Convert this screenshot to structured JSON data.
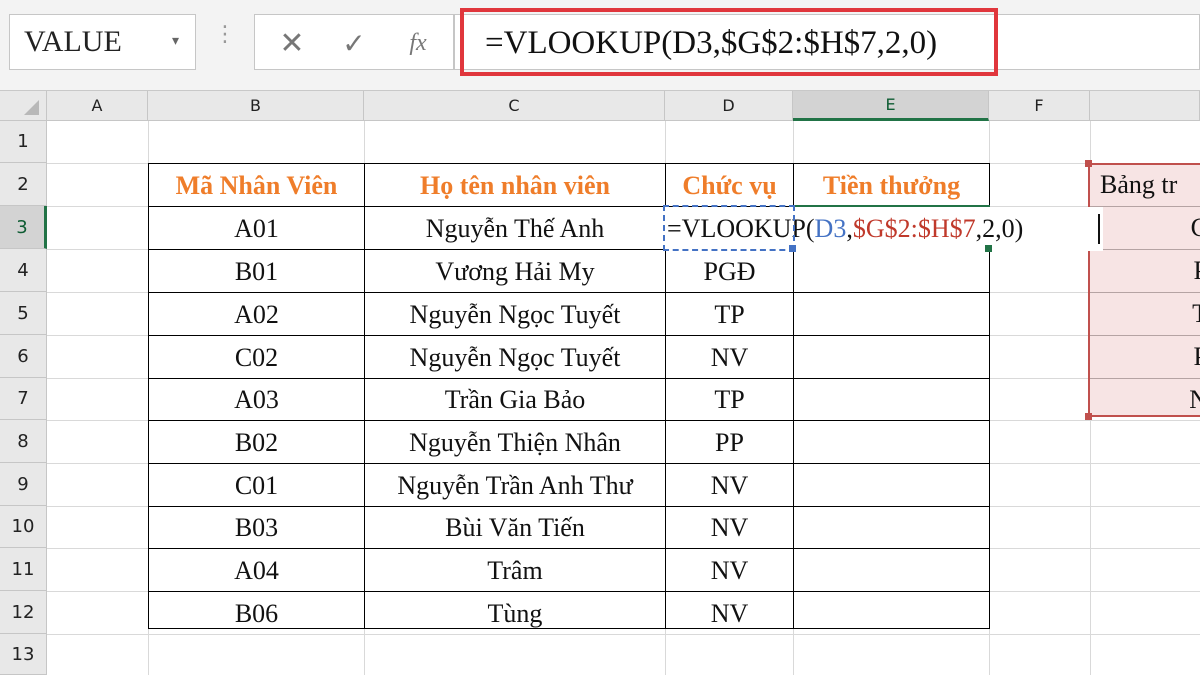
{
  "formula_bar": {
    "name_box": "VALUE",
    "name_box_arrow": "▾",
    "separator": "⋮",
    "cancel_icon": "✕",
    "enter_icon": "✓",
    "fx_label": "fx",
    "formula": "=VLOOKUP(D3,$G$2:$H$7,2,0)",
    "highlight_color": "#e0363c"
  },
  "columns": [
    "A",
    "B",
    "C",
    "D",
    "E",
    "F"
  ],
  "rows": [
    "1",
    "2",
    "3",
    "4",
    "5",
    "6",
    "7",
    "8",
    "9",
    "10",
    "11",
    "12",
    "13"
  ],
  "table": {
    "headers": [
      "Mã Nhân Viên",
      "Họ tên nhân viên",
      "Chức vụ",
      "Tiền thưởng"
    ],
    "header_color": "#ef7d2a",
    "rows": [
      {
        "id": "A01",
        "name": "Nguyễn Thế Anh",
        "position": ""
      },
      {
        "id": "B01",
        "name": "Vương Hải My",
        "position": "PGĐ"
      },
      {
        "id": "A02",
        "name": "Nguyễn Ngọc Tuyết",
        "position": "TP"
      },
      {
        "id": "C02",
        "name": "Nguyễn Ngọc Tuyết",
        "position": "NV"
      },
      {
        "id": "A03",
        "name": "Trần Gia Bảo",
        "position": "TP"
      },
      {
        "id": "B02",
        "name": "Nguyễn Thiện Nhân",
        "position": "PP"
      },
      {
        "id": "C01",
        "name": "Nguyễn Trần Anh Thư",
        "position": "NV"
      },
      {
        "id": "B03",
        "name": "Bùi Văn Tiến",
        "position": "NV"
      },
      {
        "id": "A04",
        "name": "Trâm",
        "position": "NV"
      },
      {
        "id": "B06",
        "name": "Tùng",
        "position": "NV"
      }
    ]
  },
  "active_cell": {
    "ref": "E3",
    "edit_parts": [
      "=VLOOKUP(",
      "D3",
      ",",
      "$G$2:$H$7",
      ",2,0)"
    ],
    "ref_colors": [
      "#4472c4",
      "#c0392b"
    ]
  },
  "lookup_table": {
    "title": "Bảng tr",
    "visible_cells": [
      "C",
      "P",
      "T",
      "P",
      "N"
    ]
  }
}
